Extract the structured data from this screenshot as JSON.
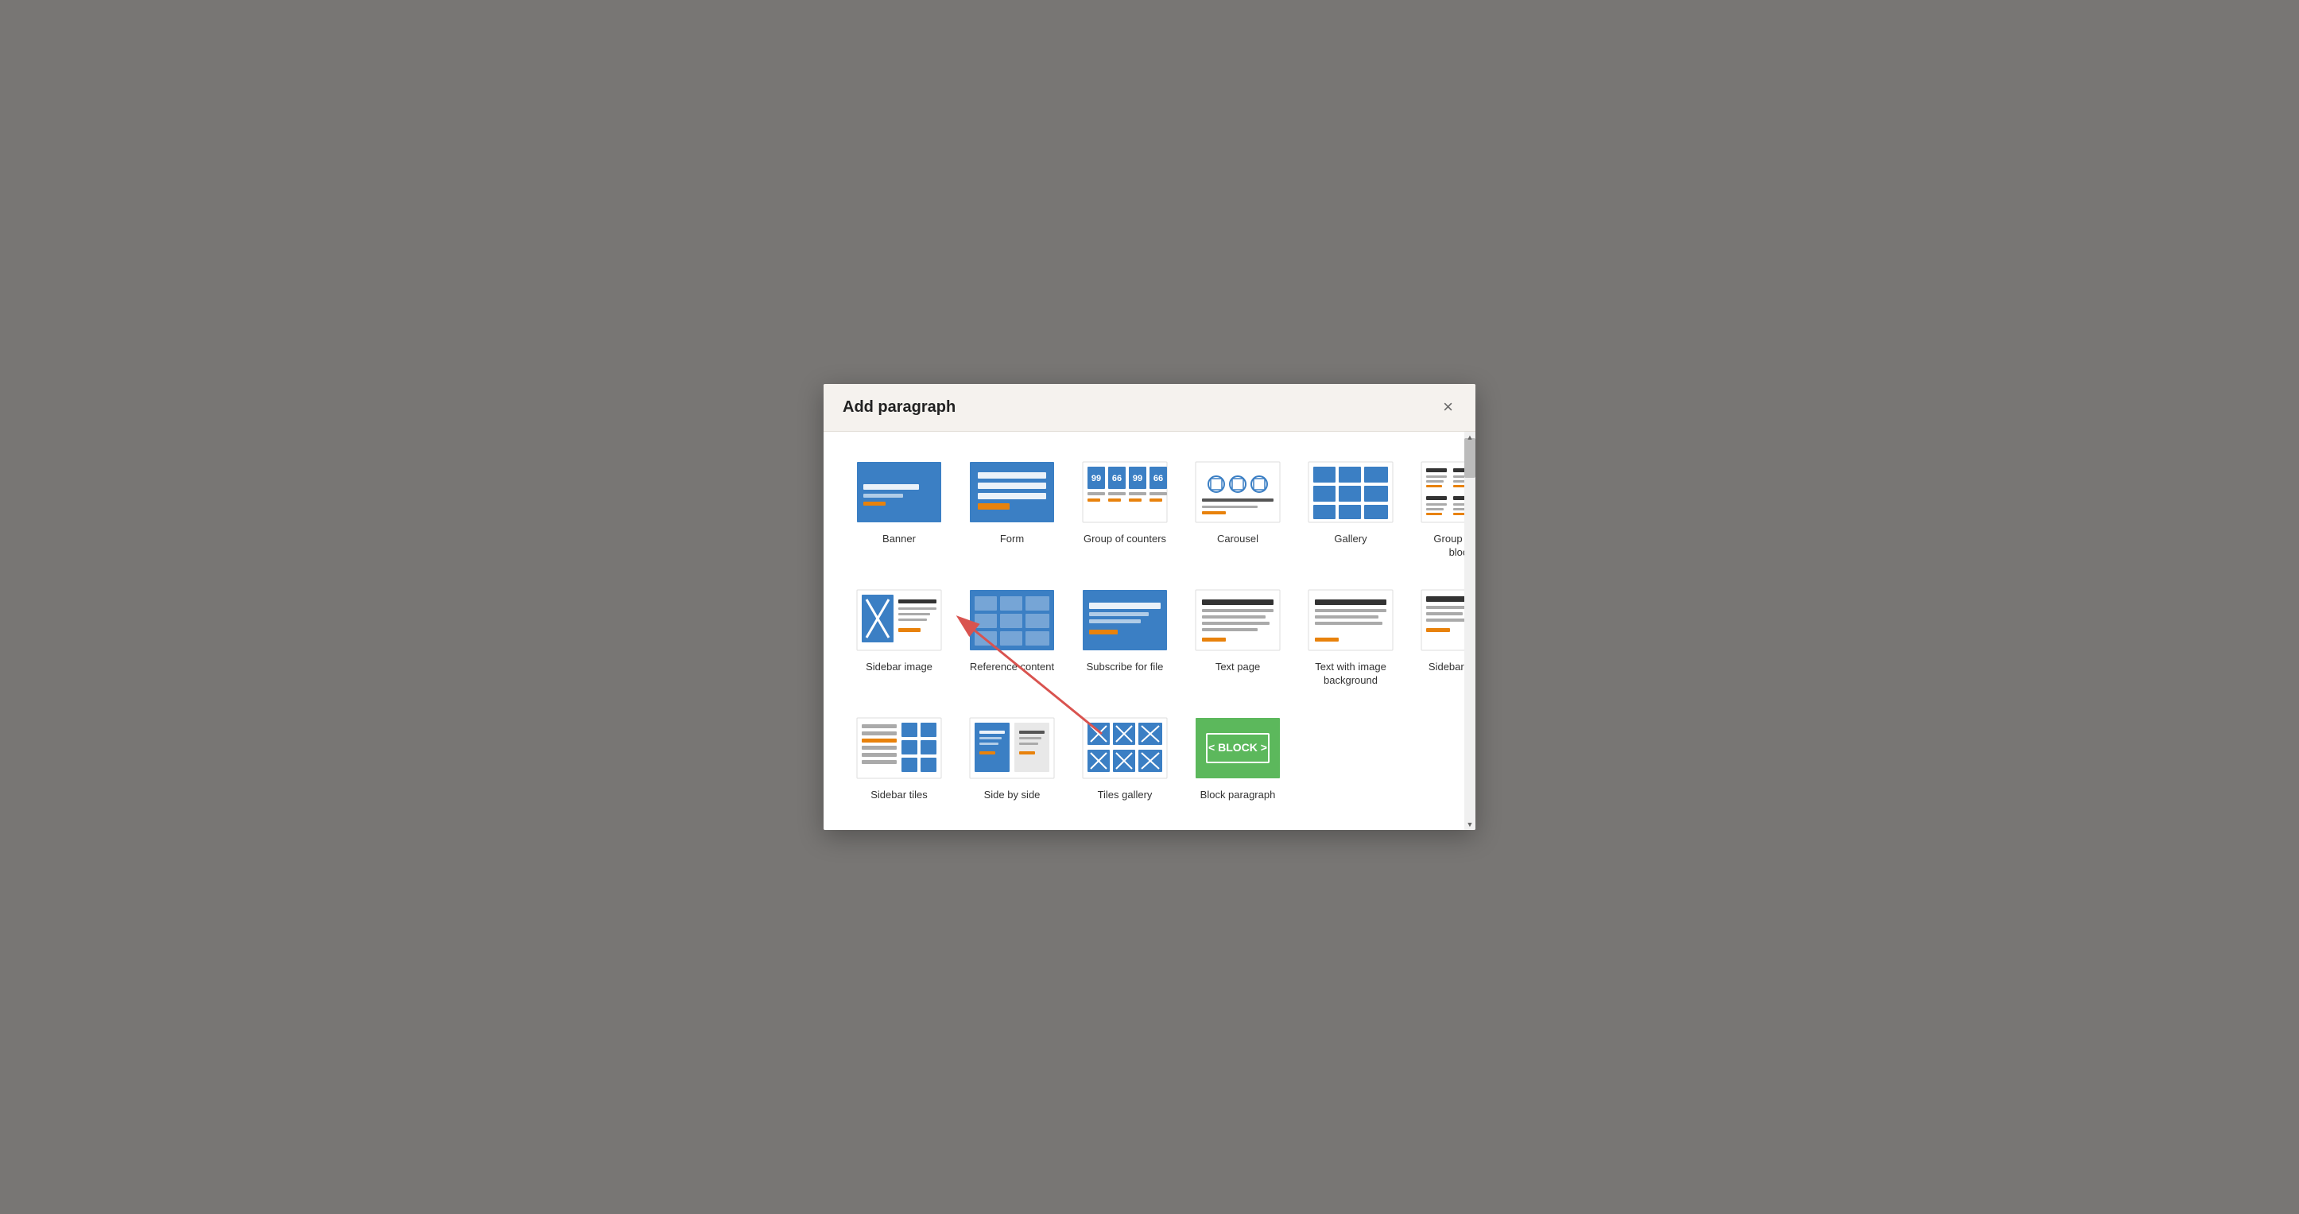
{
  "modal": {
    "title": "Add paragraph",
    "close_label": "×"
  },
  "items": [
    {
      "id": "banner",
      "label": "Banner",
      "icon": "banner"
    },
    {
      "id": "form",
      "label": "Form",
      "icon": "form"
    },
    {
      "id": "group-of-counters",
      "label": "Group of counters",
      "icon": "group-of-counters"
    },
    {
      "id": "carousel",
      "label": "Carousel",
      "icon": "carousel"
    },
    {
      "id": "gallery",
      "label": "Gallery",
      "icon": "gallery"
    },
    {
      "id": "group-of-text-blocks",
      "label": "Group of text blocks",
      "icon": "group-of-text-blocks"
    },
    {
      "id": "sidebar-image",
      "label": "Sidebar image",
      "icon": "sidebar-image"
    },
    {
      "id": "reference-content",
      "label": "Reference content",
      "icon": "reference-content"
    },
    {
      "id": "subscribe-for-file",
      "label": "Subscribe for file",
      "icon": "subscribe-for-file"
    },
    {
      "id": "text-page",
      "label": "Text page",
      "icon": "text-page"
    },
    {
      "id": "text-with-image-background",
      "label": "Text with image background",
      "icon": "text-with-image-background"
    },
    {
      "id": "sidebar-embed",
      "label": "Sidebar embed",
      "icon": "sidebar-embed"
    },
    {
      "id": "sidebar-tiles",
      "label": "Sidebar tiles",
      "icon": "sidebar-tiles"
    },
    {
      "id": "side-by-side",
      "label": "Side by side",
      "icon": "side-by-side"
    },
    {
      "id": "tiles-gallery",
      "label": "Tiles gallery",
      "icon": "tiles-gallery"
    },
    {
      "id": "block-paragraph",
      "label": "Block paragraph",
      "icon": "block-paragraph"
    }
  ],
  "colors": {
    "blue": "#3b7fc4",
    "orange": "#e8820c",
    "green": "#5cb85c",
    "dark_blue": "#1a5276",
    "light_blue": "#aed6f1",
    "gray": "#95a5a6",
    "dark": "#2c3e50",
    "white": "#ffffff"
  }
}
